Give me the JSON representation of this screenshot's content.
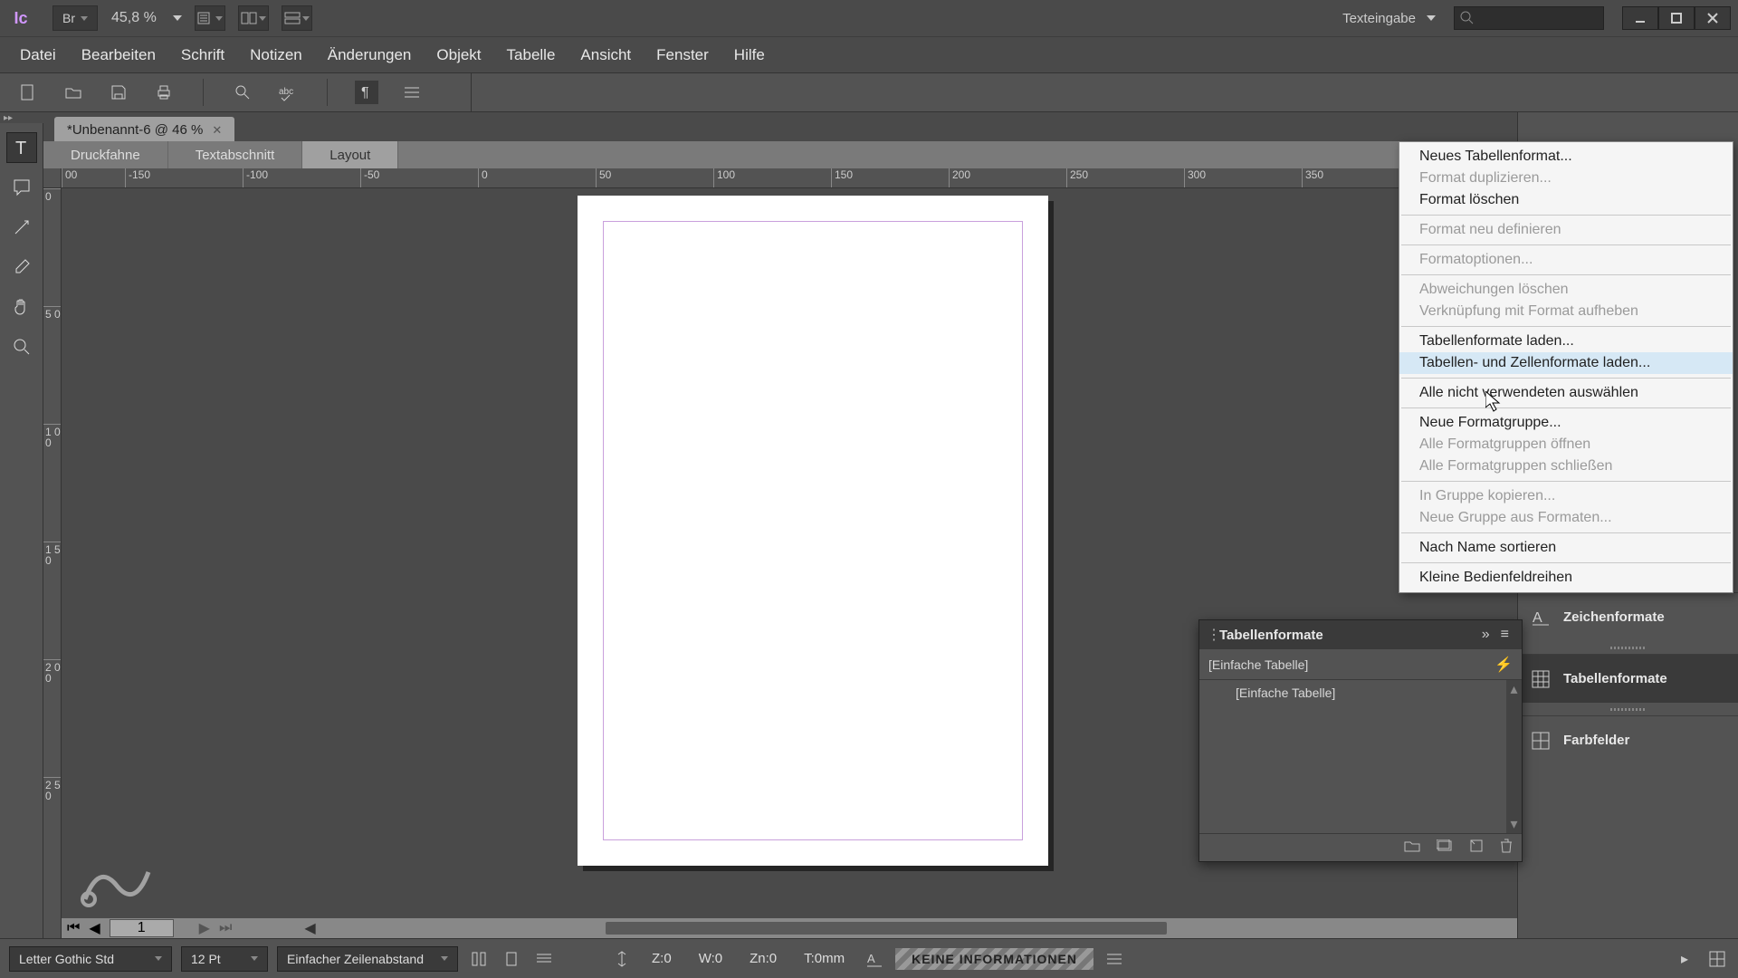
{
  "titlebar": {
    "app": "Ic",
    "bridge": "Br",
    "zoom": "45,8 %",
    "workspace": "Texteingabe"
  },
  "menu": {
    "items": [
      "Datei",
      "Bearbeiten",
      "Schrift",
      "Notizen",
      "Änderungen",
      "Objekt",
      "Tabelle",
      "Ansicht",
      "Fenster",
      "Hilfe"
    ]
  },
  "doc": {
    "tab": "*Unbenannt-6 @ 46 %",
    "view_tabs": [
      "Druckfahne",
      "Textabschnitt",
      "Layout"
    ],
    "ruler_h": [
      "00",
      "-150",
      "-100",
      "-50",
      "0",
      "50",
      "100",
      "150",
      "200",
      "250",
      "300",
      "350"
    ],
    "ruler_v": [
      "0",
      "5 0",
      "1 0 0",
      "1 5 0",
      "2 0 0",
      "2 5 0"
    ],
    "page_nav": "1"
  },
  "dock": {
    "items": [
      {
        "label": "Zeichenformate"
      },
      {
        "label": "Tabellenformate"
      },
      {
        "label": "Farbfelder"
      }
    ]
  },
  "tf_panel": {
    "title": "Tabellenformate",
    "strip": "[Einfache Tabelle]",
    "list_item": "[Einfache Tabelle]"
  },
  "ctx": {
    "items": [
      {
        "t": "Neues Tabellenformat...",
        "d": false
      },
      {
        "t": "Format duplizieren...",
        "d": true
      },
      {
        "t": "Format löschen",
        "d": false
      },
      {
        "sep": true
      },
      {
        "t": "Format neu definieren",
        "d": true
      },
      {
        "sep": true
      },
      {
        "t": "Formatoptionen...",
        "d": true
      },
      {
        "sep": true
      },
      {
        "t": "Abweichungen löschen",
        "d": true
      },
      {
        "t": "Verknüpfung mit Format aufheben",
        "d": true
      },
      {
        "sep": true
      },
      {
        "t": "Tabellenformate laden...",
        "d": false
      },
      {
        "t": "Tabellen- und Zellenformate laden...",
        "d": false,
        "hover": true
      },
      {
        "sep": true
      },
      {
        "t": "Alle nicht verwendeten auswählen",
        "d": false
      },
      {
        "sep": true
      },
      {
        "t": "Neue Formatgruppe...",
        "d": false
      },
      {
        "t": "Alle Formatgruppen öffnen",
        "d": true
      },
      {
        "t": "Alle Formatgruppen schließen",
        "d": true
      },
      {
        "sep": true
      },
      {
        "t": "In Gruppe kopieren...",
        "d": true
      },
      {
        "t": "Neue Gruppe aus Formaten...",
        "d": true
      },
      {
        "sep": true
      },
      {
        "t": "Nach Name sortieren",
        "d": false
      },
      {
        "sep": true
      },
      {
        "t": "Kleine Bedienfeldreihen",
        "d": false
      }
    ]
  },
  "status": {
    "font": "Letter Gothic Std",
    "size": "12 Pt",
    "leading": "Einfacher Zeilenabstand",
    "z": "Z:0",
    "w": "W:0",
    "zn": "Zn:0",
    "t": "T:0mm",
    "info": "KEINE INFORMATIONEN"
  }
}
